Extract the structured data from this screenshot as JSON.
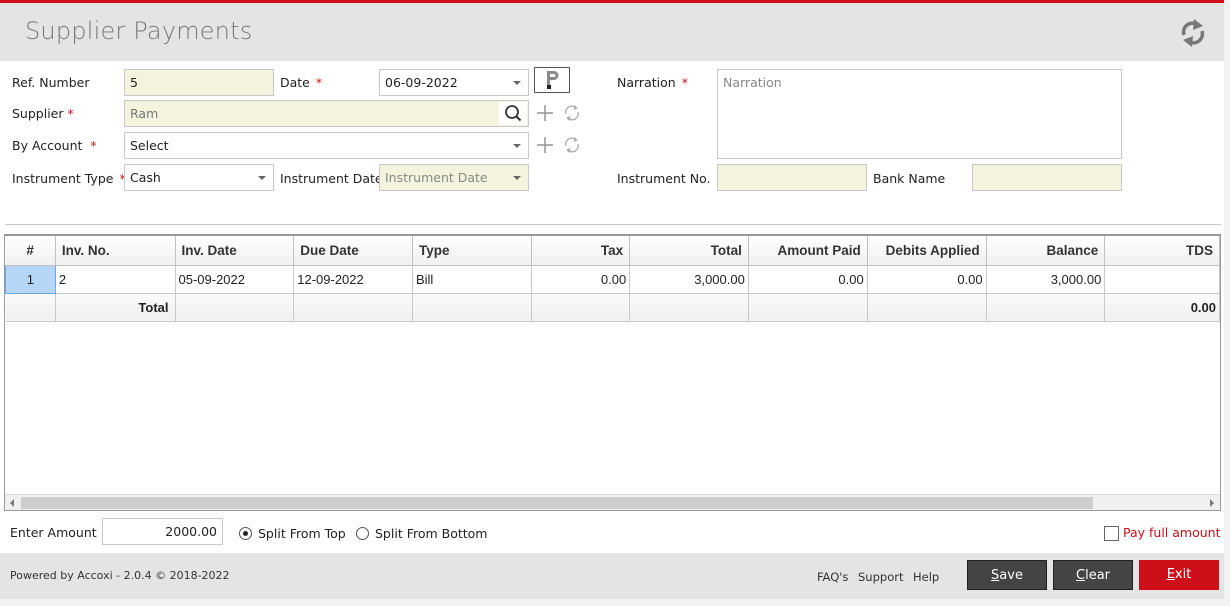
{
  "header": {
    "title": "Supplier Payments",
    "refresh_icon": "refresh-icon"
  },
  "form": {
    "ref_number": {
      "label": "Ref. Number",
      "value": "5"
    },
    "date": {
      "label": "Date",
      "required": "*",
      "value": "06-09-2022"
    },
    "print_icon": "print-icon",
    "supplier": {
      "label": "Supplier",
      "required": "*",
      "value": "Ram",
      "search_icon": "search-icon",
      "add_icon": "plus-icon",
      "refresh_icon": "refresh-icon"
    },
    "by_account": {
      "label": "By Account",
      "required": "*",
      "value": "Select",
      "add_icon": "plus-icon",
      "refresh_icon": "refresh-icon"
    },
    "instrument_type": {
      "label": "Instrument Type",
      "required": "*",
      "value": "Cash"
    },
    "instrument_date": {
      "label": "Instrument Date",
      "placeholder": "Instrument Date"
    },
    "narration": {
      "label": "Narration",
      "required": "*",
      "placeholder": "Narration"
    },
    "instrument_no": {
      "label": "Instrument No.",
      "value": ""
    },
    "bank_name": {
      "label": "Bank Name",
      "value": ""
    }
  },
  "grid": {
    "columns": [
      "#",
      "Inv. No.",
      "Inv. Date",
      "Due Date",
      "Type",
      "Tax",
      "Total",
      "Amount Paid",
      "Debits Applied",
      "Balance",
      "TDS"
    ],
    "rows": [
      {
        "index": "1",
        "inv_no": "2",
        "inv_date": "05-09-2022",
        "due_date": "12-09-2022",
        "type": "Bill",
        "tax": "0.00",
        "total": "3,000.00",
        "amount_paid": "0.00",
        "debits_applied": "0.00",
        "balance": "3,000.00",
        "tds": ""
      }
    ],
    "total_row": {
      "label": "Total",
      "tds": "0.00"
    }
  },
  "amount": {
    "label": "Enter Amount",
    "value": "2000.00",
    "split_top": "Split From Top",
    "split_bottom": "Split From Bottom",
    "selected_split": "top",
    "pay_full": "Pay full amount",
    "pay_full_checked": false,
    "pay_full_color": "#cc0f18"
  },
  "footer": {
    "powered": "Powered by Accoxi - 2.0.4 © 2018-2022",
    "links": [
      "FAQ's",
      "Support",
      "Help"
    ],
    "save": {
      "mnemonic": "S",
      "rest": "ave"
    },
    "clear": {
      "mnemonic": "C",
      "rest": "lear"
    },
    "exit": {
      "mnemonic": "E",
      "rest": "xit"
    }
  },
  "colors": {
    "accent": "#d0111b",
    "field_yellow": "#f4f4de",
    "selected_cell": "#b6d6f7",
    "button_dark": "#444444"
  }
}
